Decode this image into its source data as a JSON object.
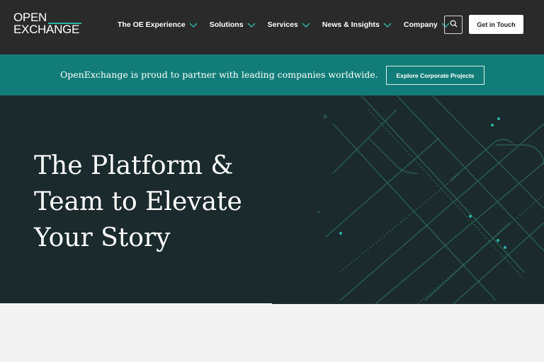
{
  "brand": {
    "logo_line1": "OPEN",
    "logo_line2": "EXCHANGE",
    "accent_color": "#2bb3a5"
  },
  "nav": {
    "items": [
      {
        "label": "The OE Experience"
      },
      {
        "label": "Solutions"
      },
      {
        "label": "Services"
      },
      {
        "label": "News & Insights"
      },
      {
        "label": "Company"
      }
    ],
    "search_icon": "search-icon",
    "cta_label": "Get in Touch"
  },
  "banner": {
    "text": "OpenExchange is proud to partner with leading companies worldwide.",
    "button_label": "Explore Corporate Projects",
    "color": "#127d78"
  },
  "hero": {
    "title_lines": [
      "The Platform &",
      "Team to Elevate",
      "Your Story"
    ],
    "background": "#1b2b2d"
  }
}
